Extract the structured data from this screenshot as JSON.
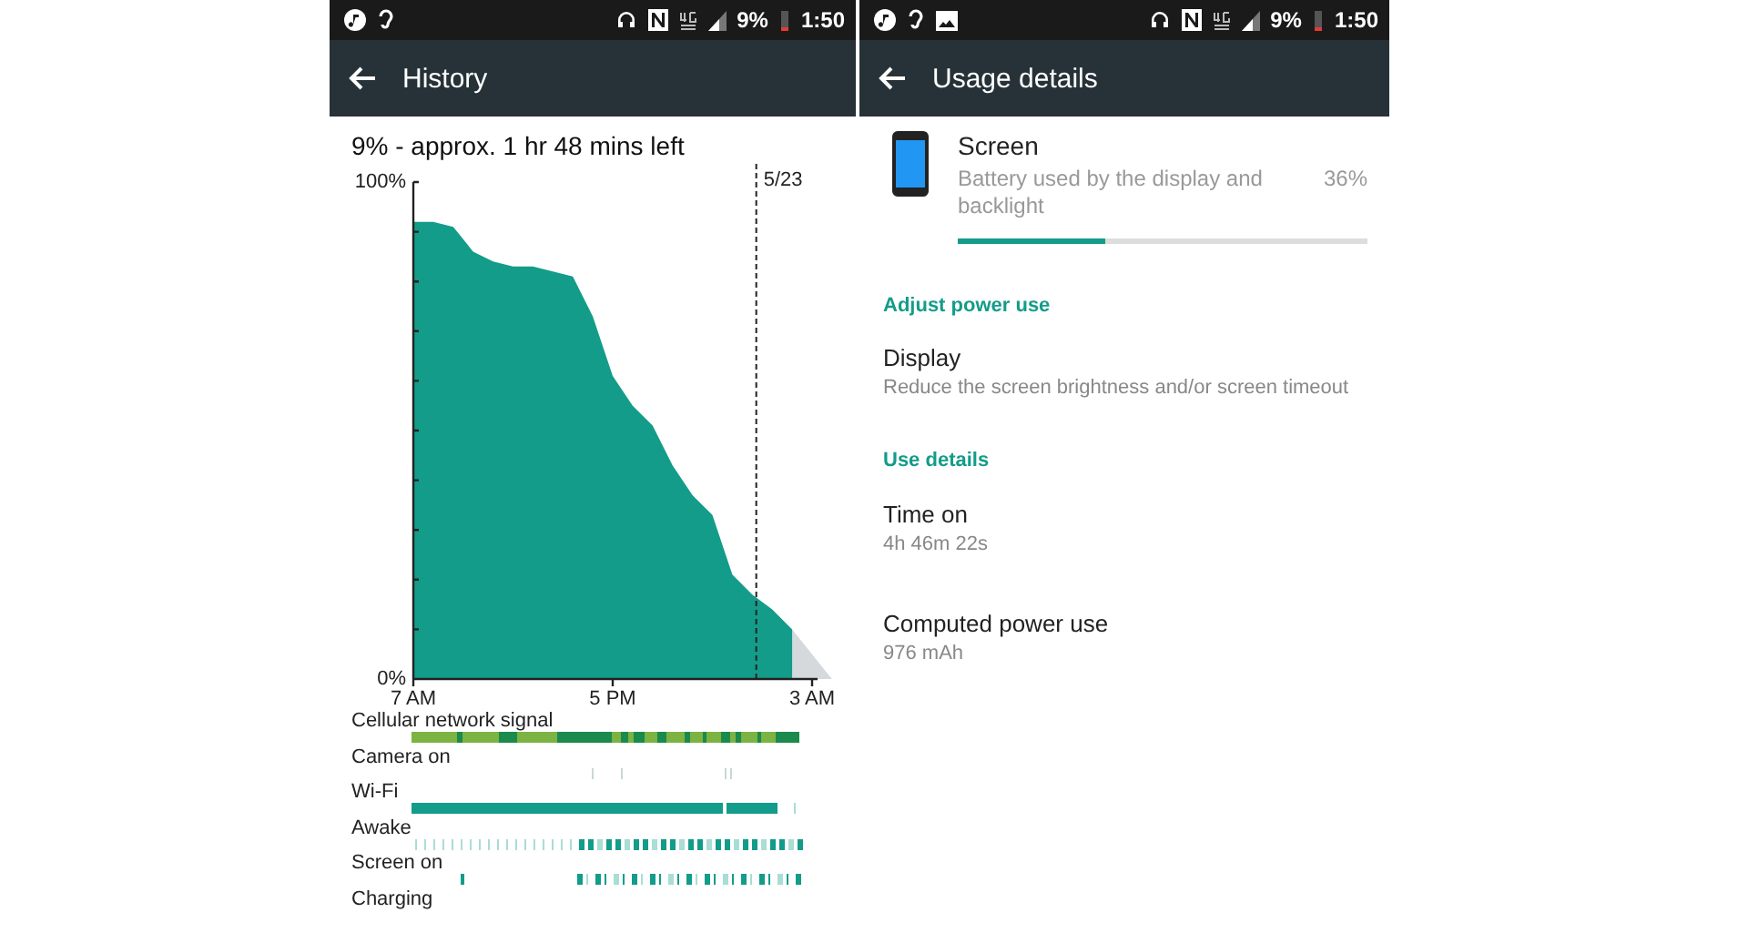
{
  "screens": [
    {
      "status_bar": {
        "battery": "9%",
        "time": "1:50"
      },
      "toolbar": {
        "title": "History"
      },
      "summary": "9% - approx. 1 hr 48 mins left",
      "chart_data": {
        "type": "area",
        "categories": [
          "7 AM",
          null,
          null,
          null,
          null,
          null,
          null,
          null,
          null,
          null,
          "5 PM",
          null,
          null,
          null,
          null,
          null,
          null,
          null,
          null,
          null,
          "3 AM"
        ],
        "ylim": [
          0,
          100
        ],
        "yticks": [
          {
            "value": 0,
            "label": "0%"
          },
          {
            "value": 100,
            "label": "100%"
          }
        ],
        "series": [
          {
            "color": "#139c89",
            "values": [
              92,
              92,
              91,
              86,
              84,
              83,
              83,
              82,
              81,
              73,
              61,
              55,
              51,
              43,
              37,
              33,
              21,
              17,
              14,
              10,
              null
            ]
          }
        ],
        "annotations": [
          "5/23"
        ]
      },
      "activity": [
        {
          "label": "Cellular network signal",
          "kind": "signal"
        },
        {
          "label": "Camera on",
          "kind": "sparse"
        },
        {
          "label": "Wi-Fi",
          "kind": "solid"
        },
        {
          "label": "Awake",
          "kind": "dense"
        },
        {
          "label": "Screen on",
          "kind": "screen"
        },
        {
          "label": "Charging",
          "kind": "none"
        }
      ]
    },
    {
      "status_bar": {
        "battery": "9%",
        "time": "1:50"
      },
      "toolbar": {
        "title": "Usage details"
      },
      "usage": {
        "title": "Screen",
        "description": "Battery used by the display and backlight",
        "percent": "36%",
        "level": 0.36
      },
      "sections": [
        {
          "header": "Adjust power use",
          "items": [
            {
              "title": "Display",
              "subtitle": "Reduce the screen brightness and/or screen timeout",
              "kind": "action"
            }
          ]
        },
        {
          "header": "Use details",
          "items": [
            {
              "title": "Time on",
              "subtitle": "4h 46m 22s",
              "kind": "info"
            },
            {
              "title": "Computed power use",
              "subtitle": "976 mAh",
              "kind": "info"
            }
          ]
        }
      ]
    }
  ]
}
